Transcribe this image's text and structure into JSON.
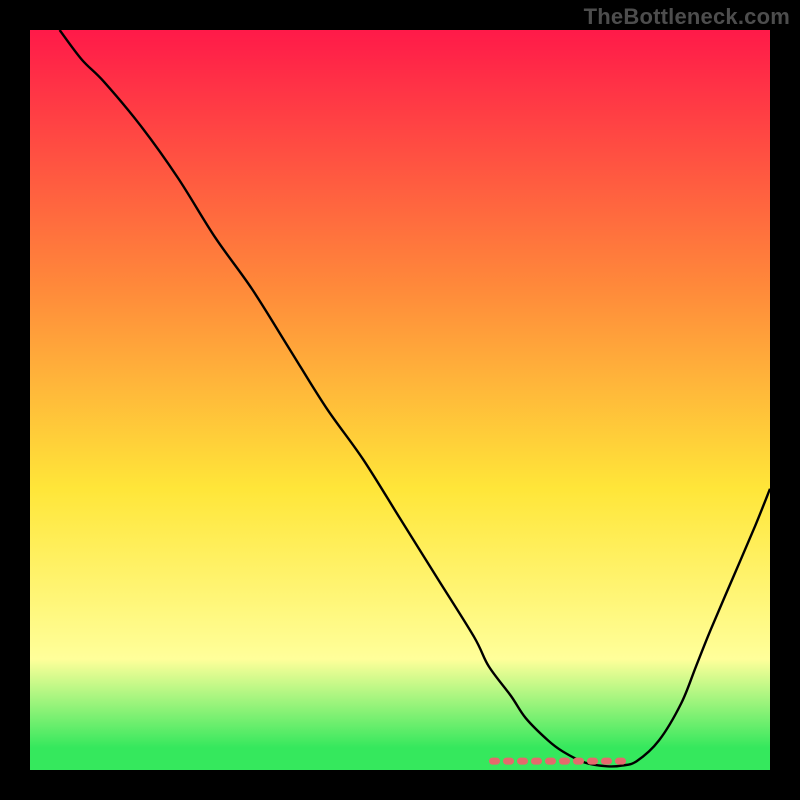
{
  "watermark": "TheBottleneck.com",
  "colors": {
    "frame": "#000000",
    "curve": "#000000",
    "floor_stroke": "#e46a6c",
    "floor_fill": "#e46a6c",
    "watermark": "#4d4d4d",
    "grad_top": "#ff1a49",
    "grad_mid1": "#ff8a3a",
    "grad_mid2": "#ffe639",
    "grad_pale": "#ffff9a",
    "grad_green": "#35e85d"
  },
  "chart_data": {
    "type": "line",
    "title": "",
    "xlabel": "",
    "ylabel": "",
    "xlim": [
      0,
      100
    ],
    "ylim": [
      0,
      100
    ],
    "x": [
      4,
      7,
      10,
      15,
      20,
      25,
      30,
      35,
      40,
      45,
      50,
      55,
      60,
      62,
      65,
      67,
      70,
      72,
      75,
      78,
      80,
      82,
      85,
      88,
      90,
      92,
      95,
      98,
      100
    ],
    "values": [
      100,
      96,
      93,
      87,
      80,
      72,
      65,
      57,
      49,
      42,
      34,
      26,
      18,
      14,
      10,
      7,
      4,
      2.5,
      1,
      0.5,
      0.6,
      1.2,
      4,
      9,
      14,
      19,
      26,
      33,
      38
    ],
    "floor": {
      "x_start": 62.5,
      "x_end": 81,
      "y": 1.2
    },
    "gradient_stops": [
      {
        "offset": 0.0,
        "key": "grad_top"
      },
      {
        "offset": 0.35,
        "key": "grad_mid1"
      },
      {
        "offset": 0.62,
        "key": "grad_mid2"
      },
      {
        "offset": 0.85,
        "key": "grad_pale"
      },
      {
        "offset": 0.97,
        "key": "grad_green"
      },
      {
        "offset": 1.0,
        "key": "grad_green"
      }
    ]
  }
}
